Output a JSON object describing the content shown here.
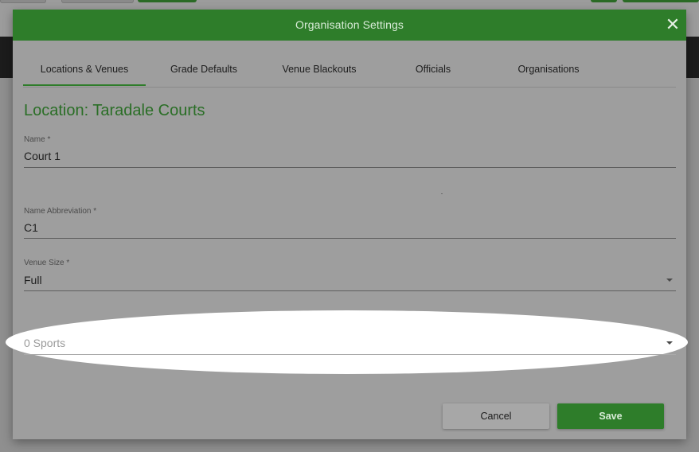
{
  "dialog": {
    "title": "Organisation Settings",
    "close_icon": "close-icon"
  },
  "tabs": [
    {
      "label": "Locations & Venues",
      "active": true
    },
    {
      "label": "Grade Defaults",
      "active": false
    },
    {
      "label": "Venue Blackouts",
      "active": false
    },
    {
      "label": "Officials",
      "active": false
    },
    {
      "label": "Organisations",
      "active": false
    }
  ],
  "section": {
    "title": "Location: Taradale Courts"
  },
  "form": {
    "name": {
      "label": "Name *",
      "value": "Court 1"
    },
    "abbreviation": {
      "label": "Name Abbreviation *",
      "value": "C1"
    },
    "venue_size": {
      "label": "Venue Size *",
      "value": "Full"
    },
    "sports": {
      "placeholder": "0 Sports"
    }
  },
  "actions": {
    "cancel_label": "Cancel",
    "save_label": "Save"
  },
  "colors": {
    "accent": "#2e7d2a",
    "overlay": "#9e9e9e"
  }
}
